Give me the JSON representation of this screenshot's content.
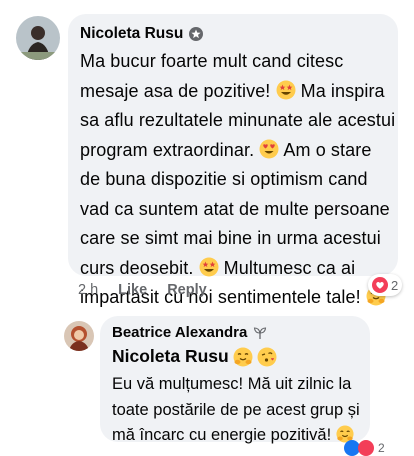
{
  "comment": {
    "author": "Nicoleta Rusu",
    "badge_icon": "star-badge-icon",
    "lines": [
      {
        "text": "Ma bucur foarte mult cand citesc",
        "emoji_after": ""
      },
      {
        "text": "mesaje asa de pozitive! ",
        "emoji_after": "star-struck-emoji",
        "tail": " Ma inspira"
      },
      {
        "text": "sa aflu rezultatele minunate ale acestui",
        "emoji_after": ""
      },
      {
        "text": "program extraordinar. ",
        "emoji_after": "heart-eyes-emoji",
        "tail": " Am o stare"
      },
      {
        "text": "de buna dispozitie si optimism cand",
        "emoji_after": ""
      },
      {
        "text": "vad ca suntem atat de multe persoane",
        "emoji_after": ""
      },
      {
        "text": "care se simt mai bine in urma acestui",
        "emoji_after": ""
      },
      {
        "text": "curs deosebit. ",
        "emoji_after": "star-struck-emoji",
        "tail": " Multumesc ca ai"
      },
      {
        "text": "impartasit cu noi sentimentele tale! ",
        "emoji_after": "hugging-emoji"
      }
    ],
    "time": "2 h",
    "like_label": "Like",
    "reply_label": "Reply",
    "reaction_count": "2",
    "reaction_icon": "love-reaction-icon"
  },
  "reply": {
    "author": "Beatrice Alexandra",
    "badge_icon": "sprout-badge-icon",
    "mention": "Nicoleta Rusu",
    "mention_emojis": [
      "hugging-emoji",
      "kissing-heart-emoji"
    ],
    "lines": [
      "Eu vă mulțumesc! Mă uit zilnic la",
      "toate postările de pe acest grup și",
      "mă încarc cu energie pozitivă! "
    ],
    "end_emoji": "hugging-emoji",
    "reaction_count": "2"
  },
  "colors": {
    "bubble": "#f0f2f5",
    "meta_text": "#65676b",
    "love_red": "#f33e58",
    "like_blue": "#1877f2",
    "emoji_yellow": "#ffcc4d"
  }
}
